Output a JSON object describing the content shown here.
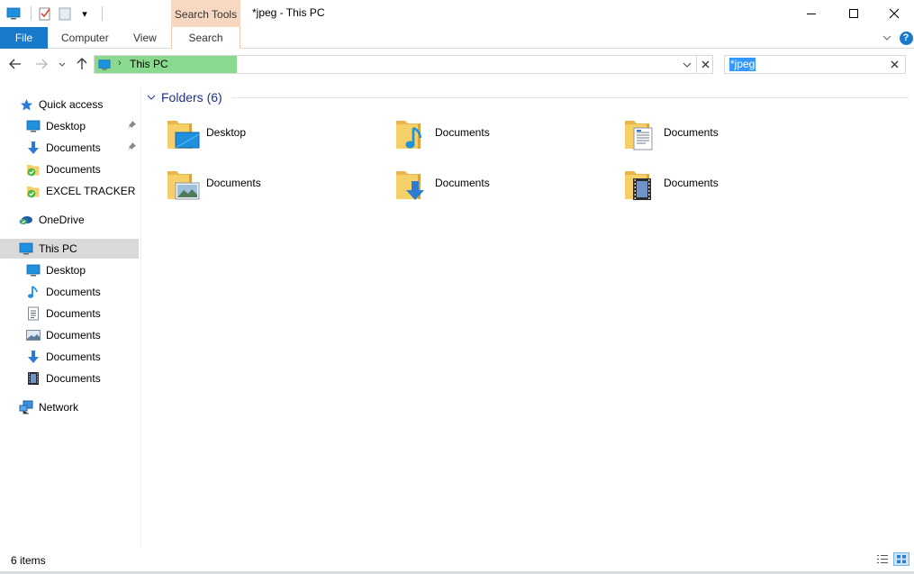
{
  "window": {
    "title": "*jpeg - This PC",
    "controls": {
      "minimize": "─",
      "maximize": "☐",
      "close": "✕"
    }
  },
  "quick_access_toolbar": {
    "dropdown_glyph": "▾"
  },
  "ribbon": {
    "context_group": "Search Tools",
    "tabs": {
      "file": "File",
      "computer": "Computer",
      "view": "View",
      "search": "Search"
    },
    "expand_glyph": "⌵",
    "help_glyph": "?"
  },
  "address_bar": {
    "breadcrumb": [
      "This PC"
    ],
    "separator": "›",
    "progress_fraction": 0.23
  },
  "search": {
    "value": "*jpeg"
  },
  "nav_pane": {
    "quick_access": "Quick access",
    "quick_items": [
      "Desktop",
      "Documents",
      "Documents",
      "EXCEL TRACKER"
    ],
    "onedrive": "OneDrive",
    "this_pc": "This PC",
    "pc_items": [
      "Desktop",
      "Documents",
      "Documents",
      "Documents",
      "Documents",
      "Documents"
    ],
    "network": "Network"
  },
  "content": {
    "group_title": "Folders (6)",
    "folders": [
      {
        "name": "Desktop",
        "icon": "desktop-folder-icon"
      },
      {
        "name": "Documents",
        "icon": "music-folder-icon"
      },
      {
        "name": "Documents",
        "icon": "documents-folder-icon"
      },
      {
        "name": "Documents",
        "icon": "pictures-folder-icon"
      },
      {
        "name": "Documents",
        "icon": "downloads-folder-icon"
      },
      {
        "name": "Documents",
        "icon": "videos-folder-icon"
      }
    ]
  },
  "status_bar": {
    "item_count": "6 items"
  },
  "colors": {
    "accent": "#1979ca",
    "context_tab": "#f9d8c2",
    "progress": "#8ad98f",
    "selection": "#d9d9d9",
    "folder": "#f5cf68",
    "group_title": "#1e3287",
    "search_highlight": "#3399ff"
  }
}
